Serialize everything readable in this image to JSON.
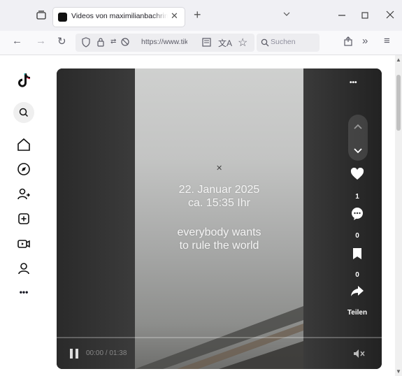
{
  "browser": {
    "tab_title": "Videos von maximilianbachring",
    "tab_close": "✕",
    "new_tab": "+",
    "url": "https://www.tik",
    "search_placeholder": "Suchen"
  },
  "video": {
    "overlay_line1": "22. Januar 2025",
    "overlay_line2": "ca. 15:35 Ihr",
    "overlay_line3": "everybody wants",
    "overlay_line4": "to rule the world",
    "likes": "1",
    "comments": "0",
    "saves": "0",
    "share_label": "Teilen",
    "time": "00:00 / 01:38",
    "more": "•••"
  },
  "sidebar": {
    "more": "•••"
  },
  "colors": {
    "tabbar_bg": "#f0f0f4",
    "video_bg": "#1a1a1a"
  }
}
